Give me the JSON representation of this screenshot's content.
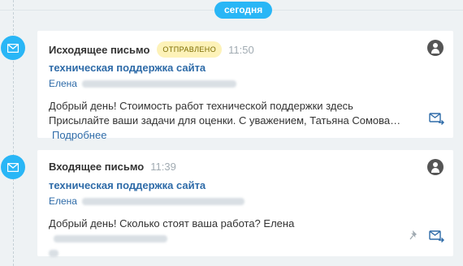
{
  "timeline": {
    "date_label": "сегодня"
  },
  "messages": [
    {
      "type_label": "Исходящее письмо",
      "status": "ОТПРАВЛЕНО",
      "time": "11:50",
      "subject": "техническая поддержка сайта",
      "sender": "Елена",
      "body": "Добрый день! Стоимость работ технической поддержки здесь Присылайте ваши задачи для оценки. С уважением, Татьяна Сомова…",
      "more_label": "Подробнее",
      "icons": [
        "envelope-icon",
        "avatar-icon",
        "reply-mail-icon"
      ]
    },
    {
      "type_label": "Входящее письмо",
      "time": "11:39",
      "subject": "техническая поддержка сайта",
      "sender": "Елена",
      "body": "Добрый день! Сколько стоят ваша работа? Елена",
      "icons": [
        "envelope-icon",
        "avatar-icon",
        "pin-icon",
        "reply-mail-icon"
      ]
    }
  ],
  "colors": {
    "accent": "#29b6f6",
    "link": "#2e6ba8",
    "badge_bg": "#fdf2b8",
    "background": "#eef2f4"
  }
}
